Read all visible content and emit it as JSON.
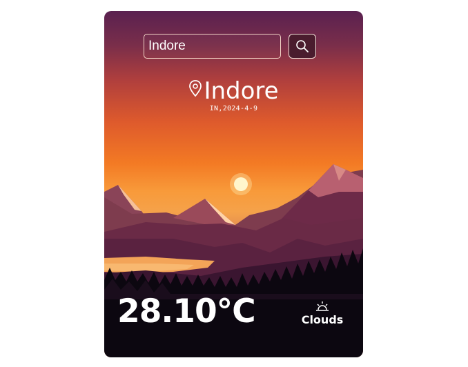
{
  "search": {
    "value": "Indore",
    "button_icon": "search-icon"
  },
  "location": {
    "icon": "map-pin-icon",
    "city": "Indore",
    "subtitle": "IN,2024-4-9"
  },
  "weather": {
    "temperature": "28.10°C",
    "condition": "Clouds",
    "condition_icon": "sunrise-icon"
  },
  "colors": {
    "sky_top": "#5a2150",
    "sky_mid": "#f37a24",
    "sun": "#fff2c2",
    "forest": "#0c0710"
  }
}
